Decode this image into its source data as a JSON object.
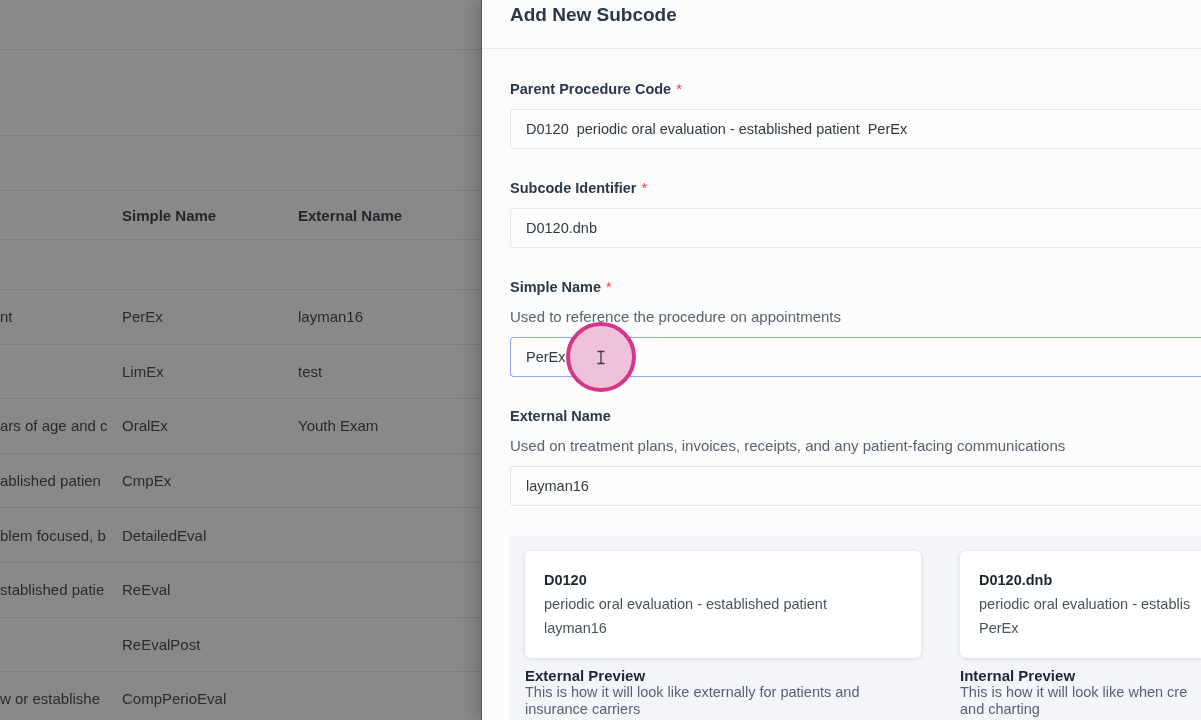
{
  "table": {
    "columns": [
      "Simple Name",
      "External Name"
    ],
    "rows": [
      {
        "column_1": "nt",
        "simple_name": "PerEx",
        "external_name": "layman16"
      },
      {
        "simple_name": "LimEx",
        "external_name": "test"
      },
      {
        "column_1": "ars of age and c",
        "simple_name": "OralEx",
        "external_name": "Youth Exam"
      },
      {
        "column_1": "ablished patien",
        "simple_name": "CmpEx"
      },
      {
        "column_1": "blem focused, b",
        "simple_name": "DetailedEval"
      },
      {
        "column_1": "stablished patie",
        "simple_name": "ReEval"
      },
      {
        "simple_name": "ReEvalPost"
      },
      {
        "column_1": "w or establishe",
        "simple_name": "CompPerioEval"
      }
    ]
  },
  "drawer": {
    "title": "Add New Subcode",
    "fields": [
      {
        "kind": "select",
        "label": "Parent Procedure Code",
        "required_mark": "*",
        "value_parts": [
          "D0120",
          "periodic oral evaluation - established patient",
          "PerEx"
        ],
        "focused": false
      },
      {
        "kind": "text",
        "label": "Subcode Identifier",
        "required_mark": "*",
        "value": "D0120.dnb",
        "focused": false
      },
      {
        "kind": "text",
        "label": "Simple Name",
        "required_mark": "*",
        "hint": "Used to reference the procedure on appointments",
        "value": "PerEx",
        "focused": true
      },
      {
        "kind": "text",
        "label": "External Name",
        "hint": "Used on treatment plans, invoices, receipts, and any patient-facing communications",
        "value": "layman16",
        "focused": false
      }
    ],
    "previews": [
      {
        "code": "D0120",
        "description": "periodic oral evaluation - established patient",
        "name": "layman16",
        "title": "External Preview",
        "caption_lines": [
          "This is how it will look like externally for patients and",
          "insurance carriers"
        ]
      },
      {
        "code": "D0120.dnb",
        "description": "periodic oral evaluation - establis",
        "name": "PerEx",
        "title": "Internal Preview",
        "caption_lines": [
          "This is how it will look like when cre",
          "and charting"
        ]
      }
    ]
  }
}
